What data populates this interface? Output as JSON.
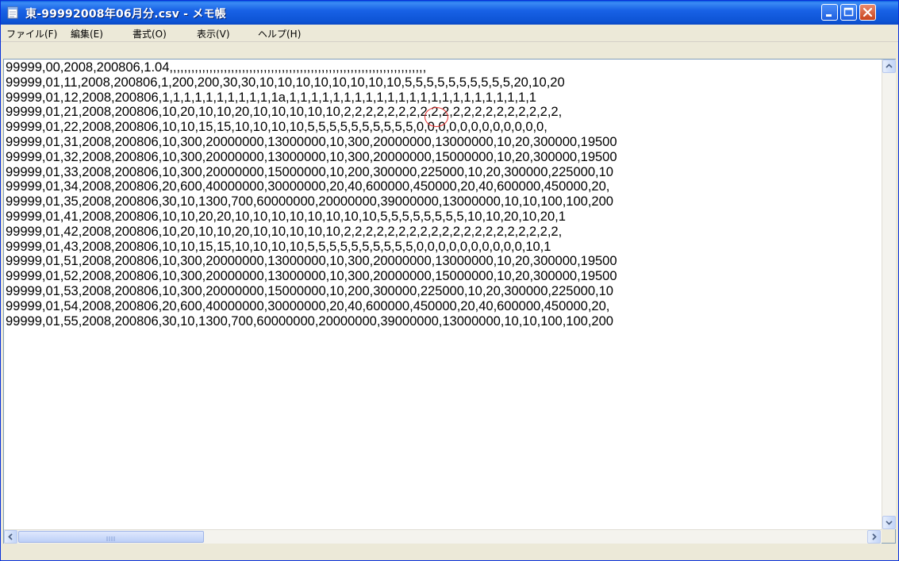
{
  "window": {
    "title": "東-99992008年06月分.csv - メモ帳",
    "controls": {
      "minimize": "minimize",
      "maximize": "maximize",
      "close": "close"
    }
  },
  "menu": {
    "file": "ファイル(F)",
    "edit": "編集(E)",
    "format": "書式(O)",
    "view": "表示(V)",
    "help": "ヘルプ(H)"
  },
  "editor": {
    "lines": [
      "99999,00,2008,200806,1.04,,,,,,,,,,,,,,,,,,,,,,,,,,,,,,,,,,,,,,,,,,,,,,,,,,,,,,,,,,,,,,,,,,,,,,,",
      "99999,01,11,2008,200806,1,200,200,30,30,10,10,10,10,10,10,10,10,5,5,5,5,5,5,5,5,5,5,20,10,20",
      "99999,01,12,2008,200806,1,1,1,1,1,1,1,1,1,1,1a,1,1,1,1,1,1,1,1,1,1,1,1,1,1,1,1,1,1,1,1,1,1,1",
      "99999,01,21,2008,200806,10,20,10,10,20,10,10,10,10,10,2,2,2,2,2,2,2,2,2,2,2,2,2,2,2,2,2,2,2,2,",
      "99999,01,22,2008,200806,10,10,15,15,10,10,10,10,5,5,5,5,5,5,5,5,5,5,0,0,0,0,0,0,0,0,0,0,0,0,",
      "99999,01,31,2008,200806,10,300,20000000,13000000,10,300,20000000,13000000,10,20,300000,19500",
      "99999,01,32,2008,200806,10,300,20000000,13000000,10,300,20000000,15000000,10,20,300000,19500",
      "99999,01,33,2008,200806,10,300,20000000,15000000,10,200,300000,225000,10,20,300000,225000,10",
      "99999,01,34,2008,200806,20,600,40000000,30000000,20,40,600000,450000,20,40,600000,450000,20,",
      "99999,01,35,2008,200806,30,10,1300,700,60000000,20000000,39000000,13000000,10,10,100,100,200",
      "99999,01,41,2008,200806,10,10,20,20,10,10,10,10,10,10,10,10,5,5,5,5,5,5,5,5,10,10,20,10,20,1",
      "99999,01,42,2008,200806,10,20,10,10,20,10,10,10,10,10,2,2,2,2,2,2,2,2,2,2,2,2,2,2,2,2,2,2,2,2,",
      "99999,01,43,2008,200806,10,10,15,15,10,10,10,10,5,5,5,5,5,5,5,5,5,5,0,0,0,0,0,0,0,0,0,0,10,1",
      "99999,01,51,2008,200806,10,300,20000000,13000000,10,300,20000000,13000000,10,20,300000,19500",
      "99999,01,52,2008,200806,10,300,20000000,13000000,10,300,20000000,15000000,10,20,300000,19500",
      "99999,01,53,2008,200806,10,300,20000000,15000000,10,200,300000,225000,10,20,300000,225000,10",
      "99999,01,54,2008,200806,20,600,40000000,30000000,20,40,600000,450000,20,40,600000,450000,20,",
      "99999,01,55,2008,200806,30,10,1300,700,60000000,20000000,39000000,13000000,10,10,100,100,200"
    ],
    "highlight": "1a"
  },
  "colors": {
    "titlebar": "#0a5ce0",
    "annotation_circle": "#e8302e"
  }
}
